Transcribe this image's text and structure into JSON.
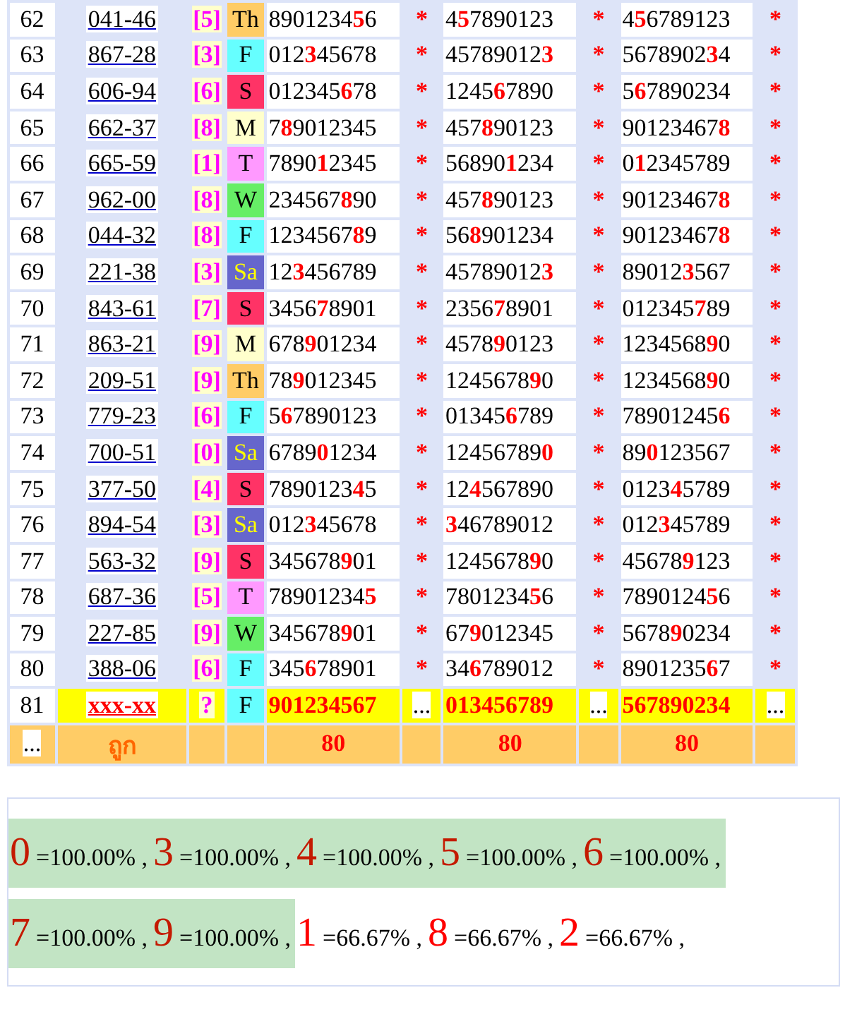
{
  "table": {
    "rows": [
      {
        "kind": "result",
        "no": "62",
        "code": "041-46",
        "pick": "[5]",
        "day": {
          "label": "Th",
          "color": "#ffcc66"
        },
        "sets": [
          {
            "before": "8901234",
            "hit": "5",
            "after": "6",
            "mark": "*"
          },
          {
            "before": "4",
            "hit": "5",
            "after": "7890123",
            "mark": "*"
          },
          {
            "before": "4",
            "hit": "5",
            "after": "6789123",
            "mark": "*"
          }
        ]
      },
      {
        "kind": "result",
        "no": "63",
        "code": "867-28",
        "pick": "[3]",
        "day": {
          "label": "F",
          "color": "#66ffff"
        },
        "sets": [
          {
            "before": "012",
            "hit": "3",
            "after": "45678",
            "mark": "*"
          },
          {
            "before": "45789012",
            "hit": "3",
            "mark": "*"
          },
          {
            "before": "5678902",
            "hit": "3",
            "after": "4",
            "mark": "*"
          }
        ]
      },
      {
        "kind": "result",
        "no": "64",
        "code": "606-94",
        "pick": "[6]",
        "day": {
          "label": "S",
          "color": "#ff3366"
        },
        "sets": [
          {
            "before": "012345",
            "hit": "6",
            "after": "78",
            "mark": "*"
          },
          {
            "before": "1245",
            "hit": "6",
            "after": "7890",
            "mark": "*"
          },
          {
            "before": "5",
            "hit": "6",
            "after": "7890234",
            "mark": "*"
          }
        ]
      },
      {
        "kind": "result",
        "no": "65",
        "code": "662-37",
        "pick": "[8]",
        "day": {
          "label": "M",
          "color": "#ffffcc"
        },
        "sets": [
          {
            "before": "7",
            "hit": "8",
            "after": "9012345",
            "mark": "*"
          },
          {
            "before": "457",
            "hit": "8",
            "after": "90123",
            "mark": "*"
          },
          {
            "before": "90123467",
            "hit": "8",
            "mark": "*"
          }
        ]
      },
      {
        "kind": "result",
        "no": "66",
        "code": "665-59",
        "pick": "[1]",
        "day": {
          "label": "T",
          "color": "#ff99ff"
        },
        "sets": [
          {
            "before": "7890",
            "hit": "1",
            "after": "2345",
            "mark": "*"
          },
          {
            "before": "56890",
            "hit": "1",
            "after": "234",
            "mark": "*"
          },
          {
            "before": "0",
            "hit": "1",
            "after": "2345789",
            "mark": "*"
          }
        ]
      },
      {
        "kind": "result",
        "no": "67",
        "code": "962-00",
        "pick": "[8]",
        "day": {
          "label": "W",
          "color": "#66ee66"
        },
        "sets": [
          {
            "before": "234567",
            "hit": "8",
            "after": "90",
            "mark": "*"
          },
          {
            "before": "457",
            "hit": "8",
            "after": "90123",
            "mark": "*"
          },
          {
            "before": "90123467",
            "hit": "8",
            "mark": "*"
          }
        ]
      },
      {
        "kind": "result",
        "no": "68",
        "code": "044-32",
        "pick": "[8]",
        "day": {
          "label": "F",
          "color": "#66ffff"
        },
        "sets": [
          {
            "before": "1234567",
            "hit": "8",
            "after": "9",
            "mark": "*"
          },
          {
            "before": "56",
            "hit": "8",
            "after": "901234",
            "mark": "*"
          },
          {
            "before": "90123467",
            "hit": "8",
            "mark": "*"
          }
        ]
      },
      {
        "kind": "result",
        "no": "69",
        "code": "221-38",
        "pick": "[3]",
        "day": {
          "label": "Sa",
          "color": "#6666cc",
          "kind": "dark"
        },
        "sets": [
          {
            "before": "12",
            "hit": "3",
            "after": "456789",
            "mark": "*"
          },
          {
            "before": "45789012",
            "hit": "3",
            "mark": "*"
          },
          {
            "before": "89012",
            "hit": "3",
            "after": "567",
            "mark": "*"
          }
        ]
      },
      {
        "kind": "result",
        "no": "70",
        "code": "843-61",
        "pick": "[7]",
        "day": {
          "label": "S",
          "color": "#ff3366"
        },
        "sets": [
          {
            "before": "3456",
            "hit": "7",
            "after": "8901",
            "mark": "*"
          },
          {
            "before": "2356",
            "hit": "7",
            "after": "8901",
            "mark": "*"
          },
          {
            "before": "012345",
            "hit": "7",
            "after": "89",
            "mark": "*"
          }
        ]
      },
      {
        "kind": "result",
        "no": "71",
        "code": "863-21",
        "pick": "[9]",
        "day": {
          "label": "M",
          "color": "#ffffcc"
        },
        "sets": [
          {
            "before": "678",
            "hit": "9",
            "after": "01234",
            "mark": "*"
          },
          {
            "before": "4578",
            "hit": "9",
            "after": "0123",
            "mark": "*"
          },
          {
            "before": "1234568",
            "hit": "9",
            "after": "0",
            "mark": "*"
          }
        ]
      },
      {
        "kind": "result",
        "no": "72",
        "code": "209-51",
        "pick": "[9]",
        "day": {
          "label": "Th",
          "color": "#ffcc66"
        },
        "sets": [
          {
            "before": "78",
            "hit": "9",
            "after": "012345",
            "mark": "*"
          },
          {
            "before": "1245678",
            "hit": "9",
            "after": "0",
            "mark": "*"
          },
          {
            "before": "1234568",
            "hit": "9",
            "after": "0",
            "mark": "*"
          }
        ]
      },
      {
        "kind": "result",
        "no": "73",
        "code": "779-23",
        "pick": "[6]",
        "day": {
          "label": "F",
          "color": "#66ffff"
        },
        "sets": [
          {
            "before": "5",
            "hit": "6",
            "after": "7890123",
            "mark": "*"
          },
          {
            "before": "01345",
            "hit": "6",
            "after": "789",
            "mark": "*"
          },
          {
            "before": "78901245",
            "hit": "6",
            "mark": "*"
          }
        ]
      },
      {
        "kind": "result",
        "no": "74",
        "code": "700-51",
        "pick": "[0]",
        "day": {
          "label": "Sa",
          "color": "#6666cc",
          "kind": "dark"
        },
        "sets": [
          {
            "before": "6789",
            "hit": "0",
            "after": "1234",
            "mark": "*"
          },
          {
            "before": "12456789",
            "hit": "0",
            "mark": "*"
          },
          {
            "before": "89",
            "hit": "0",
            "after": "123567",
            "mark": "*"
          }
        ]
      },
      {
        "kind": "result",
        "no": "75",
        "code": "377-50",
        "pick": "[4]",
        "day": {
          "label": "S",
          "color": "#ff3366"
        },
        "sets": [
          {
            "before": "7890123",
            "hit": "4",
            "after": "5",
            "mark": "*"
          },
          {
            "before": "12",
            "hit": "4",
            "after": "567890",
            "mark": "*"
          },
          {
            "before": "0123",
            "hit": "4",
            "after": "5789",
            "mark": "*"
          }
        ]
      },
      {
        "kind": "result",
        "no": "76",
        "code": "894-54",
        "pick": "[3]",
        "day": {
          "label": "Sa",
          "color": "#6666cc",
          "kind": "dark"
        },
        "sets": [
          {
            "before": "012",
            "hit": "3",
            "after": "45678",
            "mark": "*"
          },
          {
            "hit": "3",
            "after": "46789012",
            "mark": "*"
          },
          {
            "before": "012",
            "hit": "3",
            "after": "45789",
            "mark": "*"
          }
        ]
      },
      {
        "kind": "result",
        "no": "77",
        "code": "563-32",
        "pick": "[9]",
        "day": {
          "label": "S",
          "color": "#ff3366"
        },
        "sets": [
          {
            "before": "345678",
            "hit": "9",
            "after": "01",
            "mark": "*"
          },
          {
            "before": "1245678",
            "hit": "9",
            "after": "0",
            "mark": "*"
          },
          {
            "before": "45678",
            "hit": "9",
            "after": "123",
            "mark": "*"
          }
        ]
      },
      {
        "kind": "result",
        "no": "78",
        "code": "687-36",
        "pick": "[5]",
        "day": {
          "label": "T",
          "color": "#ff99ff"
        },
        "sets": [
          {
            "before": "78901234",
            "hit": "5",
            "mark": "*"
          },
          {
            "before": "7801234",
            "hit": "5",
            "after": "6",
            "mark": "*"
          },
          {
            "before": "7890124",
            "hit": "5",
            "after": "6",
            "mark": "*"
          }
        ]
      },
      {
        "kind": "result",
        "no": "79",
        "code": "227-85",
        "pick": "[9]",
        "day": {
          "label": "W",
          "color": "#66ee66"
        },
        "sets": [
          {
            "before": "345678",
            "hit": "9",
            "after": "01",
            "mark": "*"
          },
          {
            "before": "67",
            "hit": "9",
            "after": "012345",
            "mark": "*"
          },
          {
            "before": "5678",
            "hit": "9",
            "after": "0234",
            "mark": "*"
          }
        ]
      },
      {
        "kind": "result",
        "no": "80",
        "code": "388-06",
        "pick": "[6]",
        "day": {
          "label": "F",
          "color": "#66ffff"
        },
        "sets": [
          {
            "before": "345",
            "hit": "6",
            "after": "78901",
            "mark": "*"
          },
          {
            "before": "34",
            "hit": "6",
            "after": "789012",
            "mark": "*"
          },
          {
            "before": "8901235",
            "hit": "6",
            "after": "7",
            "mark": "*"
          }
        ]
      },
      {
        "kind": "pending",
        "no": "81",
        "code": "xxx-xx",
        "pick": "?",
        "day": {
          "label": "F",
          "color": "#66ffff"
        },
        "sets": [
          {
            "before": "901234567",
            "mark": "..."
          },
          {
            "before": "013456789",
            "mark": "..."
          },
          {
            "before": "567890234",
            "mark": "..."
          }
        ]
      }
    ],
    "footer": {
      "first": "...",
      "label": "ถูก",
      "counts": [
        "80",
        "80",
        "80"
      ]
    }
  },
  "stats": {
    "lines": [
      {
        "items": [
          {
            "digit": "0",
            "value": "=100.00% ,",
            "highlighted": true
          },
          {
            "digit": "3",
            "value": "=100.00% ,",
            "highlighted": true
          },
          {
            "digit": "4",
            "value": "=100.00% ,",
            "highlighted": true
          },
          {
            "digit": "5",
            "value": "=100.00% ,",
            "highlighted": true
          },
          {
            "digit": "6",
            "value": "=100.00% ,",
            "highlighted": true
          }
        ]
      },
      {
        "items": [
          {
            "digit": "7",
            "value": "=100.00% ,",
            "highlighted": true
          },
          {
            "digit": "9",
            "value": "=100.00% ,",
            "highlighted": true
          },
          {
            "digit": "1",
            "value": "=66.67% ,",
            "highlighted": false
          },
          {
            "digit": "8",
            "value": "=66.67% ,",
            "highlighted": false
          },
          {
            "digit": "2",
            "value": "=66.67% ,",
            "highlighted": false
          }
        ]
      }
    ]
  }
}
